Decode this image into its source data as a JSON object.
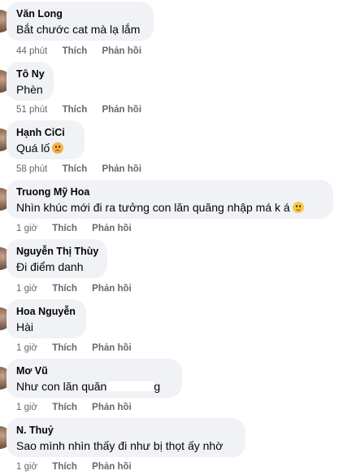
{
  "actions": {
    "like_label": "Thích",
    "reply_label": "Phản hồi"
  },
  "comments": [
    {
      "author": "Văn Long",
      "text": "Bắt chước cat mà lạ lắm",
      "time": "44 phút"
    },
    {
      "author": "Tô Ny",
      "text": "Phèn",
      "time": "51 phút"
    },
    {
      "author": "Hạnh CiCi",
      "text": "Quá lố",
      "emoji": "hot-face-emoji",
      "time": "58 phút"
    },
    {
      "author": "Truong Mỹ Hoa",
      "text": "Nhìn khúc mới đi ra tưởng con lăn quăng nhập má k á",
      "emoji": "upside-down-face-emoji",
      "time": "1 giờ"
    },
    {
      "author": "Nguyễn Thị Thùy",
      "text": "Đi điểm danh",
      "time": "1 giờ"
    },
    {
      "author": "Hoa Nguyễn",
      "text": "Hài",
      "time": "1 giờ"
    },
    {
      "author": "Mơ Vũ",
      "text": "Như con lăn quăn",
      "text_tail": "g",
      "time": "1 giờ"
    },
    {
      "author": "N. Thuỷ",
      "text": "Sao mình nhìn thấy đi như bị thọt ấy nhờ",
      "time": "1 giờ"
    }
  ]
}
